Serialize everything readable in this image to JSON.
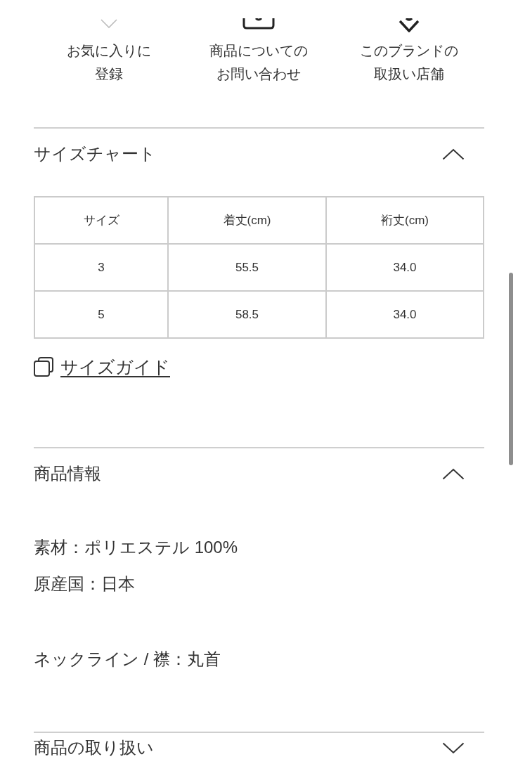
{
  "actions": [
    {
      "label": [
        "お気に入りに",
        "登録"
      ]
    },
    {
      "label": [
        "商品についての",
        "お問い合わせ"
      ]
    },
    {
      "label": [
        "このブランドの",
        "取扱い店舗"
      ]
    }
  ],
  "sections": [
    {
      "title": "サイズチャート",
      "expanded": true,
      "kind": "size_chart",
      "table": {
        "columns": [
          "サイズ",
          "着丈(cm)",
          "裄丈(cm)"
        ],
        "rows": [
          [
            "3",
            "55.5",
            "34.0"
          ],
          [
            "5",
            "58.5",
            "34.0"
          ]
        ]
      },
      "link": "サイズガイド"
    },
    {
      "title": "商品情報",
      "expanded": true,
      "kind": "text",
      "paragraphs": [
        [
          "素材：ポリエステル 100%",
          "原産国：日本"
        ],
        [
          "ネックライン / 襟：丸首"
        ]
      ]
    },
    {
      "title": "商品の取り扱い",
      "expanded": false
    }
  ]
}
